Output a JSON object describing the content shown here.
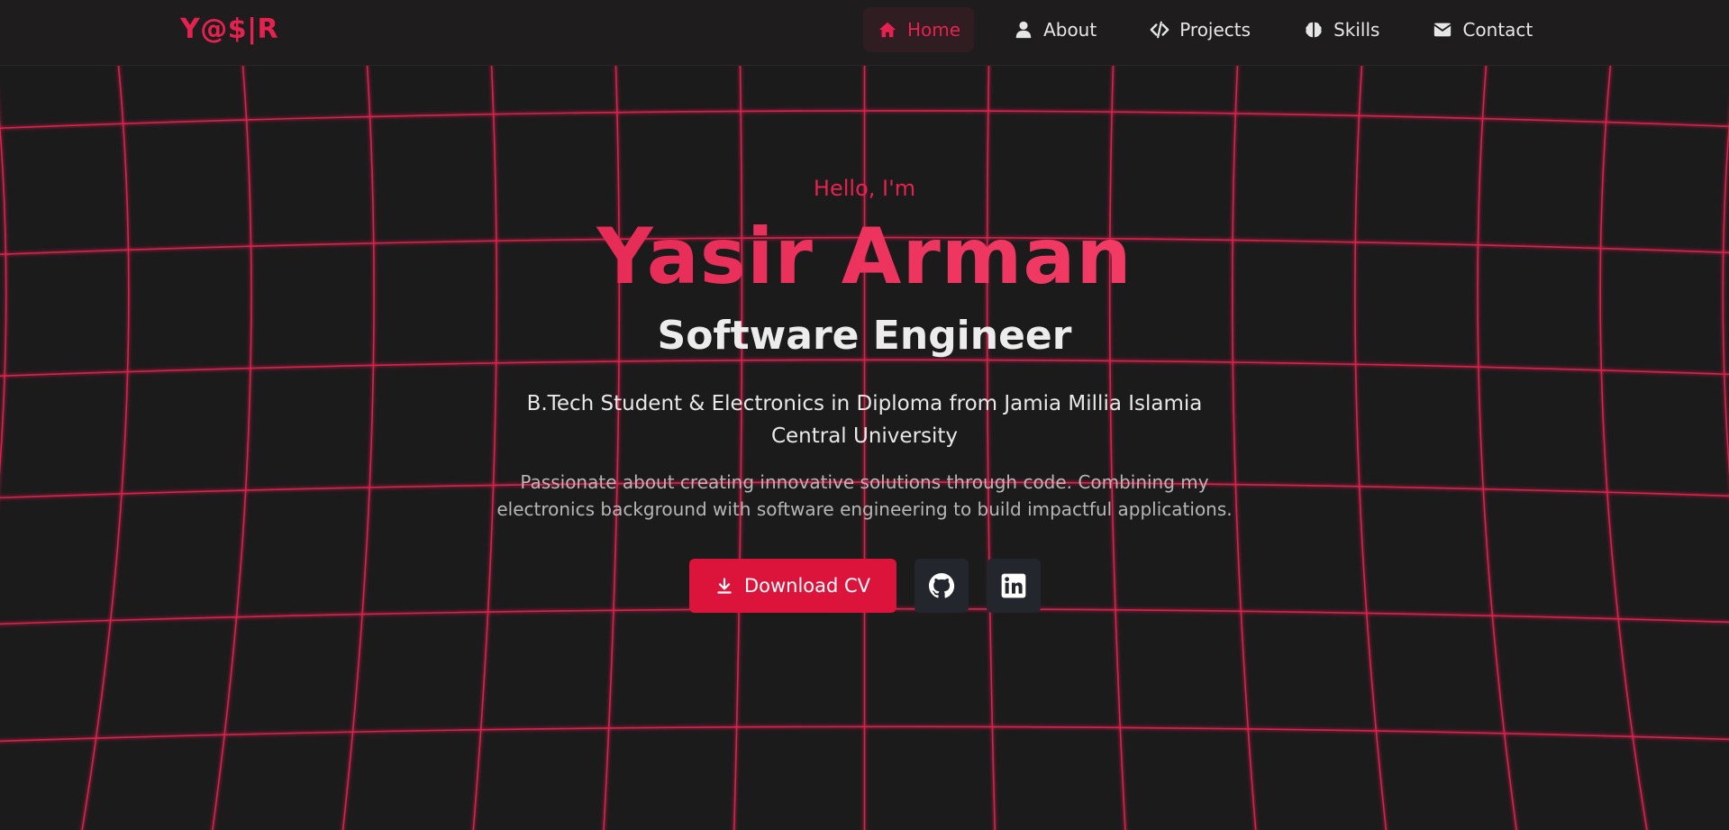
{
  "brand": {
    "logo": "Y@$|R"
  },
  "nav": {
    "items": [
      {
        "label": "Home",
        "icon": "home-icon",
        "active": true
      },
      {
        "label": "About",
        "icon": "user-icon",
        "active": false
      },
      {
        "label": "Projects",
        "icon": "code-icon",
        "active": false
      },
      {
        "label": "Skills",
        "icon": "brain-icon",
        "active": false
      },
      {
        "label": "Contact",
        "icon": "envelope-icon",
        "active": false
      }
    ]
  },
  "hero": {
    "greeting": "Hello, I'm",
    "name": "Yasir Arman",
    "role": "Software Engineer",
    "education": "B.Tech Student & Electronics in Diploma from Jamia Millia Islamia Central University",
    "about": "Passionate about creating innovative solutions through code. Combining my electronics background with software engineering to build impactful applications.",
    "cv_button": "Download CV",
    "socials": [
      {
        "icon": "github-icon"
      },
      {
        "icon": "linkedin-icon"
      }
    ]
  },
  "colors": {
    "accent": "#e5224f",
    "background": "#1c1b1c",
    "nav_background": "#1f1c1d",
    "grid_line": "#e5224f"
  }
}
